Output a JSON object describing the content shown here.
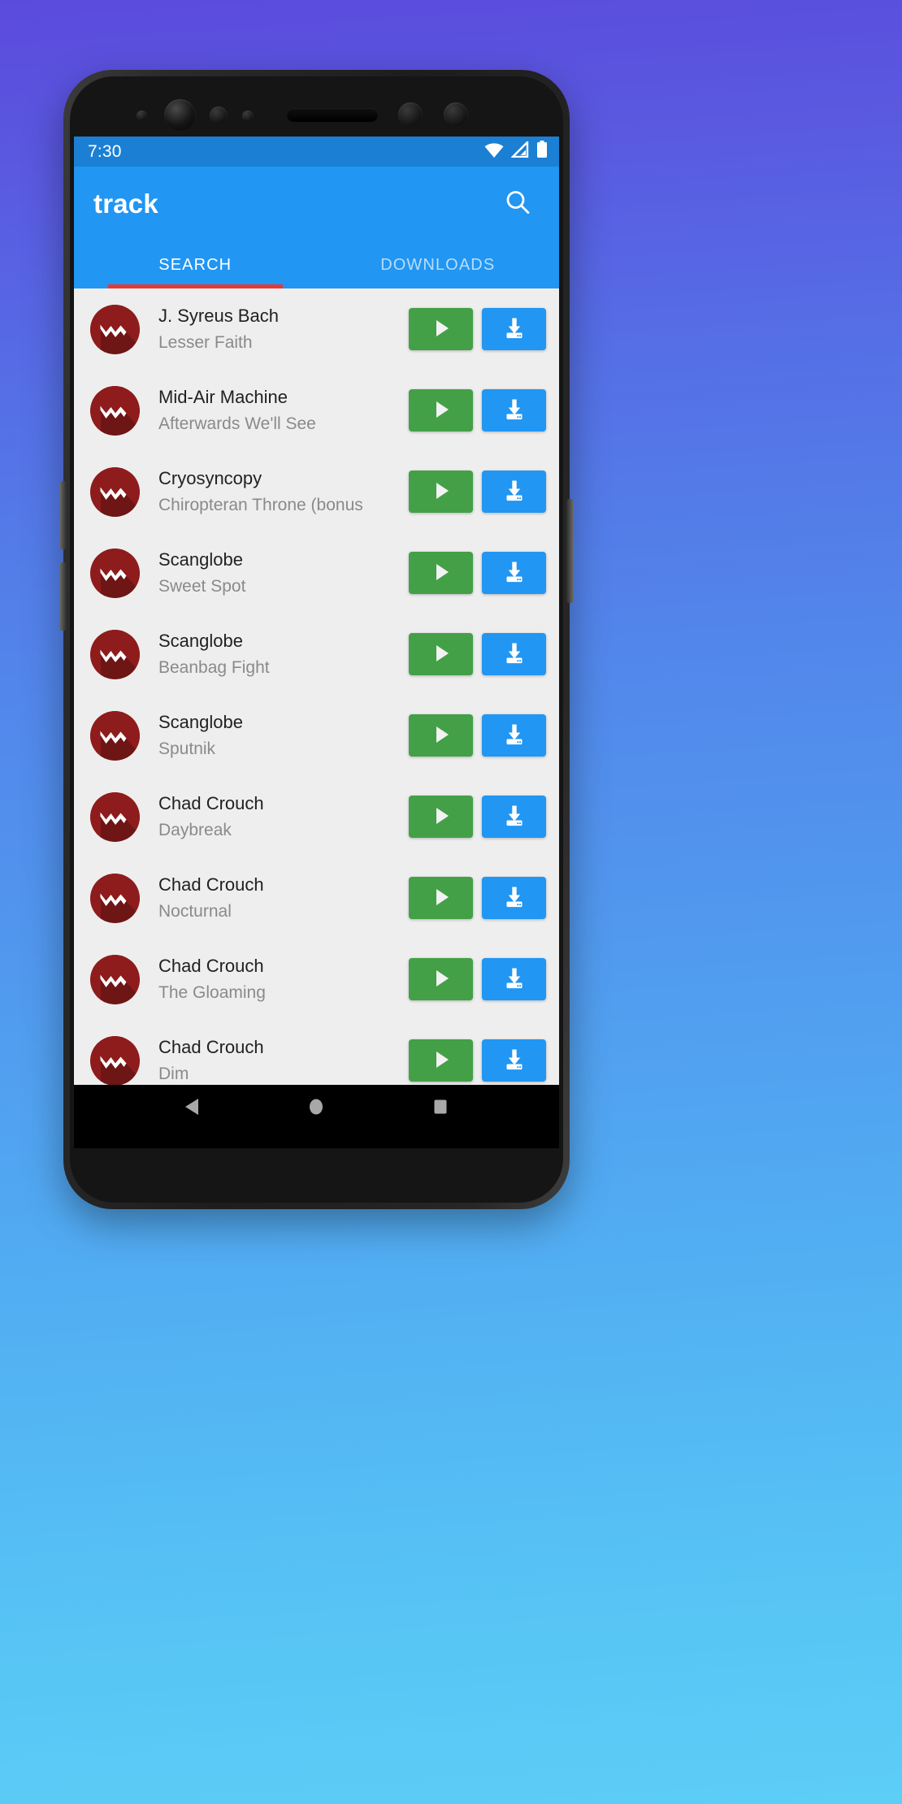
{
  "background": {
    "gradient_top": "#5b4bdd",
    "gradient_bottom": "#5dcef6"
  },
  "device": {
    "frame_color": "#232323",
    "buttons": [
      {
        "name": "volume-up",
        "side": "left"
      },
      {
        "name": "volume-down",
        "side": "left"
      },
      {
        "name": "power",
        "side": "right"
      }
    ],
    "sensors": [
      "proximity-sensor",
      "front-camera",
      "iris-scanner",
      "light-sensor",
      "earpiece-speaker",
      "sensor-dot-a",
      "sensor-dot-b"
    ]
  },
  "status_bar": {
    "time": "7:30",
    "background": "#1b7fd4",
    "icons": [
      "wifi-icon",
      "signal-icon",
      "battery-icon"
    ]
  },
  "app_bar": {
    "title": "track",
    "background": "#2196f3",
    "search_icon": "search-icon"
  },
  "tabs": {
    "indicator_color": "#e53935",
    "items": [
      {
        "label": "SEARCH",
        "active": true
      },
      {
        "label": "DOWNLOADS",
        "active": false
      }
    ]
  },
  "list": {
    "background": "#eeeeee",
    "avatar_color": "#8e1c1c",
    "avatar_icon": "wave-logo-icon",
    "play_button": {
      "label": "play-icon",
      "color": "#43a047"
    },
    "download_button": {
      "label": "download-icon",
      "color": "#2196f3"
    },
    "rows": [
      {
        "artist": "J. Syreus Bach",
        "track": "Lesser Faith"
      },
      {
        "artist": "Mid-Air Machine",
        "track": "Afterwards We'll See"
      },
      {
        "artist": "Cryosyncopy",
        "track": "Chiropteran Throne (bonus"
      },
      {
        "artist": "Scanglobe",
        "track": "Sweet Spot"
      },
      {
        "artist": "Scanglobe",
        "track": "Beanbag Fight"
      },
      {
        "artist": "Scanglobe",
        "track": "Sputnik"
      },
      {
        "artist": "Chad Crouch",
        "track": "Daybreak"
      },
      {
        "artist": "Chad Crouch",
        "track": "Nocturnal"
      },
      {
        "artist": "Chad Crouch",
        "track": "The Gloaming"
      },
      {
        "artist": "Chad Crouch",
        "track": "Dim"
      }
    ]
  },
  "nav_bar": {
    "background": "#000000",
    "items": [
      {
        "name": "back-button"
      },
      {
        "name": "home-button"
      },
      {
        "name": "recents-button"
      }
    ]
  }
}
